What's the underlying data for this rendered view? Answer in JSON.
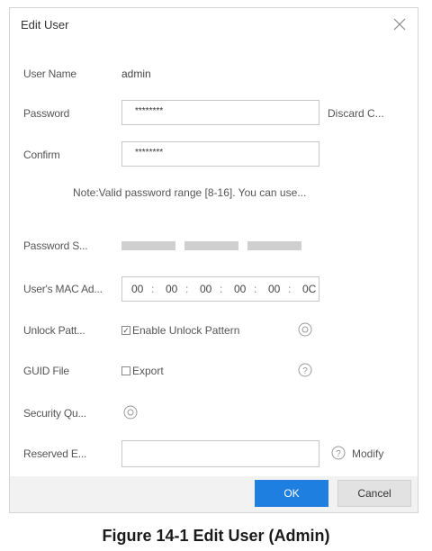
{
  "dialog": {
    "title": "Edit User",
    "close_icon": "close-icon"
  },
  "fields": {
    "user_name": {
      "label": "User Name",
      "value": "admin"
    },
    "password": {
      "label": "Password",
      "value": "********"
    },
    "discard_link": "Discard C...",
    "confirm": {
      "label": "Confirm",
      "value": "********"
    },
    "note": "Note:Valid password range [8-16]. You can use...",
    "password_strength": {
      "label": "Password S...",
      "level_bars": 3
    },
    "mac": {
      "label": "User's MAC Ad...",
      "segments": [
        "00",
        "00",
        "00",
        "00",
        "00",
        "0C"
      ]
    },
    "unlock_pattern": {
      "label": "Unlock Patt...",
      "checkbox_label": "Enable Unlock Pattern",
      "checked": true,
      "icon": "gear-icon"
    },
    "guid_file": {
      "label": "GUID File",
      "checkbox_label": "Export",
      "checked": false,
      "icon": "help-icon"
    },
    "security_question": {
      "label": "Security Qu...",
      "icon": "gear-icon"
    },
    "reserved_email": {
      "label": "Reserved E...",
      "value": "",
      "modify_label": "Modify",
      "icon": "help-icon"
    }
  },
  "footer": {
    "ok_label": "OK",
    "cancel_label": "Cancel",
    "ok_color": "#1f7fe0"
  },
  "caption": "Figure 14-1 Edit User (Admin)"
}
